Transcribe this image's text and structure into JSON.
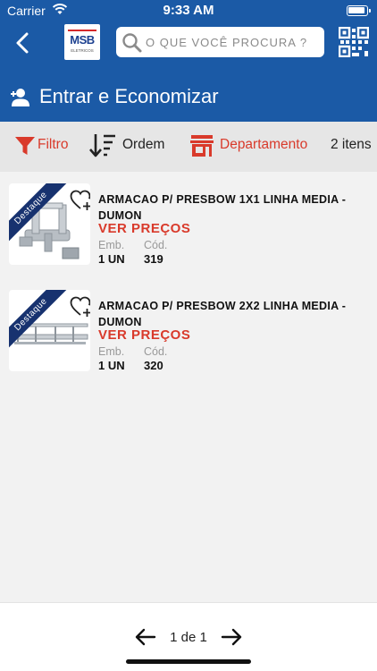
{
  "status_bar": {
    "carrier": "Carrier",
    "time": "9:33 AM"
  },
  "header": {
    "logo_text": "MSB",
    "logo_subtext": "ELETRICOS",
    "search_placeholder": "O QUE VOCÊ PROCURA ?"
  },
  "login_bar": {
    "label": "Entrar e Economizar"
  },
  "filter_bar": {
    "filter_label": "Filtro",
    "order_label": "Ordem",
    "department_label": "Departamento",
    "item_count": "2 itens"
  },
  "products": [
    {
      "badge": "Destaque",
      "name": "ARMACAO P/ PRESBOW 1X1 LINHA MEDIA - DUMON",
      "price_label": "VER PREÇOS",
      "pack_label": "Emb.",
      "pack_value": "1 UN",
      "code_label": "Cód.",
      "code_value": "319"
    },
    {
      "badge": "Destaque",
      "name": "ARMACAO P/ PRESBOW 2X2 LINHA MEDIA - DUMON",
      "price_label": "VER PREÇOS",
      "pack_label": "Emb.",
      "pack_value": "1 UN",
      "code_label": "Cód.",
      "code_value": "320"
    }
  ],
  "pagination": {
    "label": "1 de 1"
  },
  "colors": {
    "primary": "#1b5aa6",
    "accent": "#d93a2b",
    "badge": "#17326f"
  },
  "icons": [
    "wifi-icon",
    "battery-icon",
    "back-arrow-icon",
    "search-icon",
    "qr-code-icon",
    "add-user-icon",
    "filter-icon",
    "sort-icon",
    "store-icon",
    "heart-plus-icon",
    "arrow-left-icon",
    "arrow-right-icon"
  ]
}
